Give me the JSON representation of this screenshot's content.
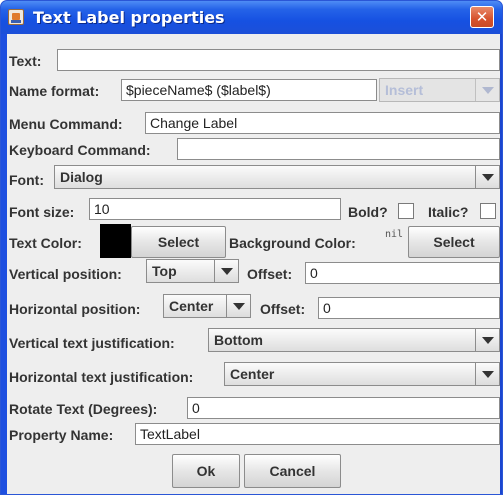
{
  "window": {
    "title": "Text Label properties",
    "close_glyph": "✕"
  },
  "text_label": "Text:",
  "text_value": "",
  "name_format": {
    "label": "Name format:",
    "value": "$pieceName$ ($label$)",
    "insert": "Insert"
  },
  "menu_command": {
    "label": "Menu Command:",
    "value": "Change Label"
  },
  "keyboard_command": {
    "label": "Keyboard Command:",
    "value": ""
  },
  "font": {
    "label": "Font:",
    "value": "Dialog"
  },
  "font_size": {
    "label": "Font size:",
    "value": "10"
  },
  "bold": {
    "label": "Bold?",
    "checked": false
  },
  "italic": {
    "label": "Italic?",
    "checked": false
  },
  "text_color": {
    "label": "Text Color:",
    "swatch": "#000000",
    "select": "Select"
  },
  "background_color": {
    "label": "Background Color:",
    "swatch": "nil",
    "select": "Select"
  },
  "vertical_position": {
    "label": "Vertical position:",
    "value": "Top",
    "offset_label": "Offset:",
    "offset": "0"
  },
  "horizontal_position": {
    "label": "Horizontal position:",
    "value": "Center",
    "offset_label": "Offset:",
    "offset": "0"
  },
  "vertical_justification": {
    "label": "Vertical text justification:",
    "value": "Bottom"
  },
  "horizontal_justification": {
    "label": "Horizontal text justification:",
    "value": "Center"
  },
  "rotate": {
    "label": "Rotate Text (Degrees):",
    "value": "0"
  },
  "property_name": {
    "label": "Property Name:",
    "value": "TextLabel"
  },
  "buttons": {
    "ok": "Ok",
    "cancel": "Cancel"
  },
  "colors": {
    "title_bar": "#1c4fd8",
    "dialog_bg": "#eeeeee",
    "close_button": "#d6522d"
  }
}
